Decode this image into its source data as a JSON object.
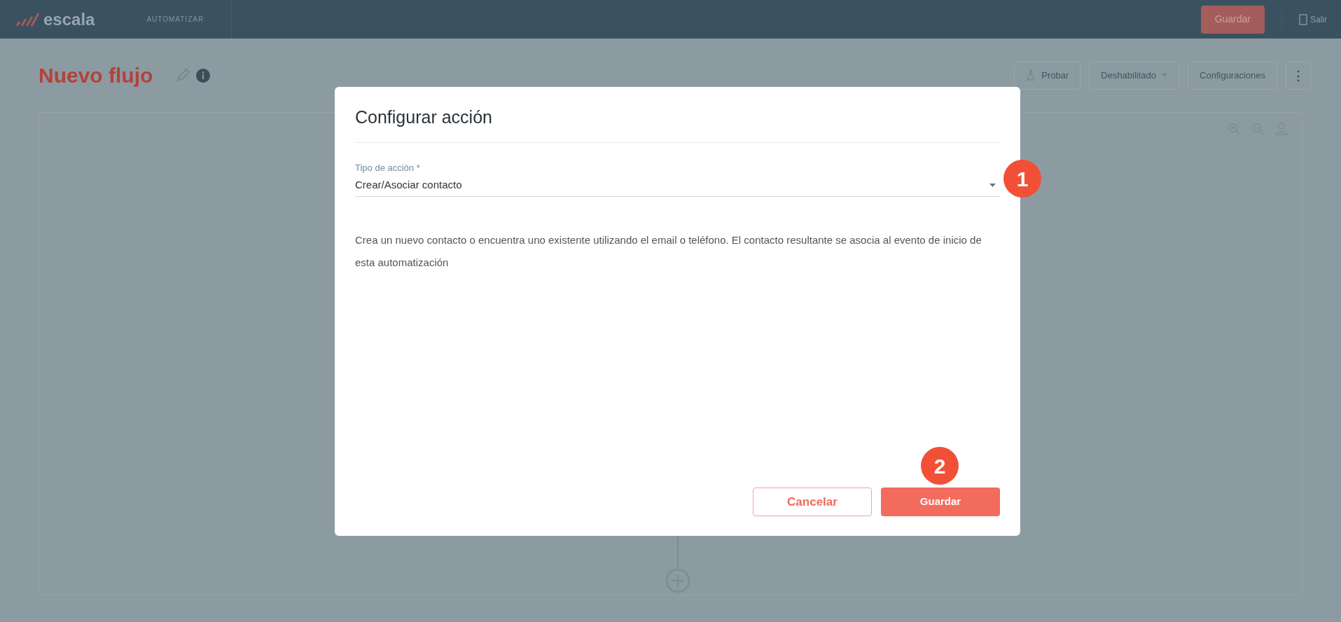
{
  "top_bar": {
    "logo": "escala",
    "section": "AUTOMATIZAR",
    "save_button": "Guardar",
    "exit_button": "Salir"
  },
  "header": {
    "title": "Nuevo flujo",
    "buttons": [
      {
        "kind": "test",
        "label": "Probar"
      },
      {
        "kind": "dropdown",
        "label": "Deshabilitado"
      },
      {
        "kind": "plain",
        "label": "Configuraciones"
      },
      {
        "kind": "more",
        "label": "⋮"
      }
    ]
  },
  "dialog": {
    "title": "Configurar acción",
    "field": {
      "label": "Tipo de acción *",
      "value": "Crear/Asociar contacto"
    },
    "description": "Crea un nuevo contacto o encuentra uno existente utilizando el email o teléfono. El contacto resultante se asocia al evento de inicio de esta automatización",
    "cancel_button": "Cancelar",
    "save_button": "Guardar"
  },
  "step_markers": [
    {
      "label": "1"
    },
    {
      "label": "2"
    }
  ]
}
